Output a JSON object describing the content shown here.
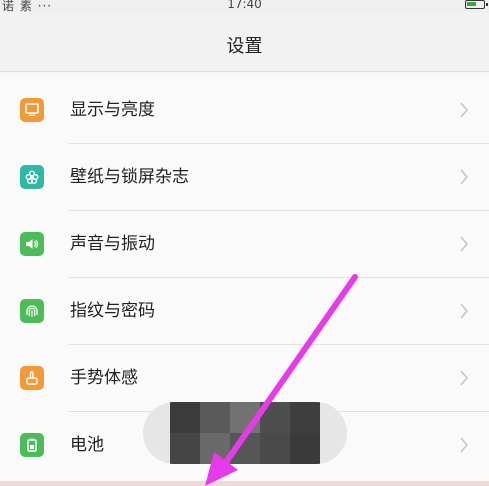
{
  "status_bar": {
    "left_text": "诺 素 ···",
    "time": "17:40",
    "battery_color": "#3ca53c"
  },
  "header": {
    "title": "设置"
  },
  "settings": {
    "items": [
      {
        "label": "显示与亮度",
        "icon": "display-icon",
        "color": "#f29a3a"
      },
      {
        "label": "壁纸与锁屏杂志",
        "icon": "wallpaper-flower-icon",
        "color": "#2fb8a2"
      },
      {
        "label": "声音与振动",
        "icon": "speaker-icon",
        "color": "#4cbc58"
      },
      {
        "label": "指纹与密码",
        "icon": "fingerprint-icon",
        "color": "#4cbc58"
      },
      {
        "label": "手势体感",
        "icon": "gesture-hand-icon",
        "color": "#f29a3a"
      },
      {
        "label": "电池",
        "icon": "battery-icon",
        "color": "#4cbc58"
      }
    ]
  },
  "annotation": {
    "arrow_color": "#e53be8"
  }
}
